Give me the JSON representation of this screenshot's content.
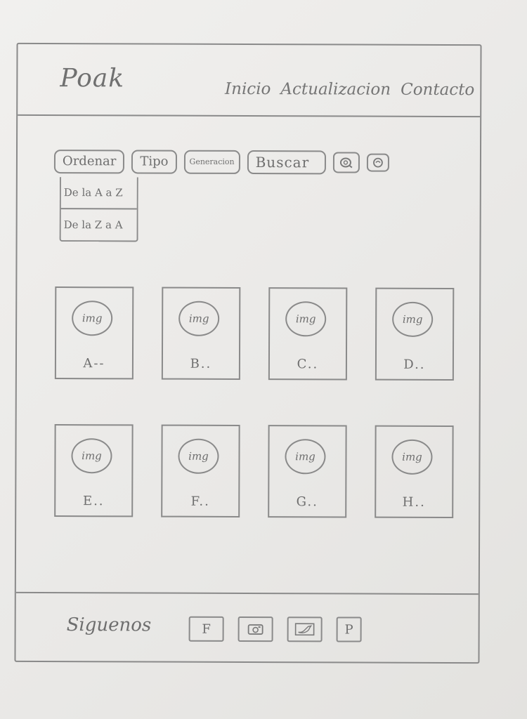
{
  "header": {
    "logo": "Poak",
    "nav": [
      {
        "label": "Inicio"
      },
      {
        "label": "Actualizacion"
      },
      {
        "label": "Contacto"
      }
    ]
  },
  "toolbar": {
    "sort_label": "Ordenar",
    "type_label": "Tipo",
    "generation_label": "Generacion",
    "search_label": "Buscar",
    "icons": [
      "search-icon",
      "settings-icon"
    ]
  },
  "sort_dropdown": {
    "options": [
      {
        "label": "De la A a Z"
      },
      {
        "label": "De la Z a A"
      }
    ]
  },
  "cards": [
    {
      "image_label": "img",
      "name": "A--"
    },
    {
      "image_label": "img",
      "name": "B.."
    },
    {
      "image_label": "img",
      "name": "C.."
    },
    {
      "image_label": "img",
      "name": "D.."
    },
    {
      "image_label": "img",
      "name": "E.."
    },
    {
      "image_label": "img",
      "name": "F.."
    },
    {
      "image_label": "img",
      "name": "G.."
    },
    {
      "image_label": "img",
      "name": "H.."
    }
  ],
  "footer": {
    "follow_label": "Siguenos",
    "social": [
      {
        "glyph": "F",
        "icon": "facebook-icon"
      },
      {
        "glyph": "",
        "icon": "instagram-icon"
      },
      {
        "glyph": "",
        "icon": "twitter-icon"
      },
      {
        "glyph": "P",
        "icon": "pinterest-icon"
      }
    ]
  }
}
